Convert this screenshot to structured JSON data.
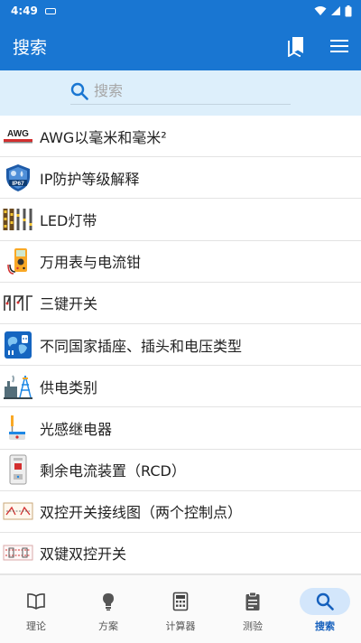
{
  "status_bar": {
    "time": "4:49"
  },
  "app_bar": {
    "title": "搜索"
  },
  "search": {
    "placeholder": "搜索",
    "value": ""
  },
  "items": [
    {
      "label": "AWG以毫米和毫米²",
      "icon": "awg-icon",
      "badge": "AWG"
    },
    {
      "label": "IP防护等级解释",
      "icon": "ip-rating-icon",
      "badge": "IP67"
    },
    {
      "label": "LED灯带",
      "icon": "led-strip-icon"
    },
    {
      "label": "万用表与电流钳",
      "icon": "multimeter-icon"
    },
    {
      "label": "三键开关",
      "icon": "three-way-switch-icon"
    },
    {
      "label": "不同国家插座、插头和电压类型",
      "icon": "socket-world-icon"
    },
    {
      "label": "供电类别",
      "icon": "power-supply-icon"
    },
    {
      "label": "光感继电器",
      "icon": "photo-relay-icon"
    },
    {
      "label": "剩余电流装置（RCD）",
      "icon": "rcd-icon"
    },
    {
      "label": "双控开关接线图（两个控制点）",
      "icon": "two-way-switch-icon"
    },
    {
      "label": "双键双控开关",
      "icon": "double-two-way-switch-icon"
    }
  ],
  "bottom_nav": [
    {
      "label": "理论",
      "icon": "book-icon",
      "active": false
    },
    {
      "label": "方案",
      "icon": "bulb-icon",
      "active": false
    },
    {
      "label": "计算器",
      "icon": "calculator-icon",
      "active": false
    },
    {
      "label": "测验",
      "icon": "quiz-icon",
      "active": false
    },
    {
      "label": "搜索",
      "icon": "search-icon",
      "active": true
    }
  ],
  "colors": {
    "primary": "#1976d2",
    "search_bg": "#ddeffb",
    "active_pill": "#d3e6fb"
  }
}
